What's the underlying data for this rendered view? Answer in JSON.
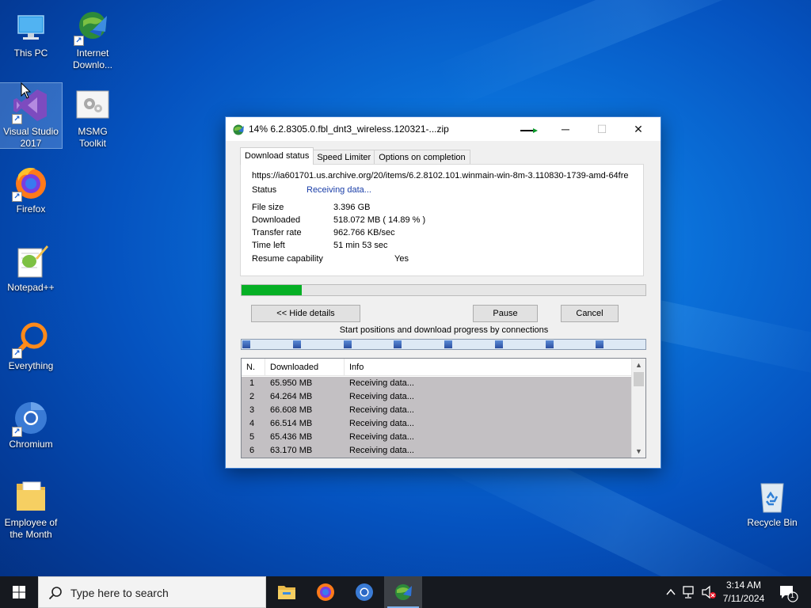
{
  "desktop": {
    "icons": [
      {
        "id": "this-pc",
        "label": "This PC"
      },
      {
        "id": "idm",
        "label": "Internet Downlo..."
      },
      {
        "id": "visual-studio",
        "label": "Visual Studio 2017"
      },
      {
        "id": "msmg",
        "label": "MSMG Toolkit"
      },
      {
        "id": "firefox",
        "label": "Firefox"
      },
      {
        "id": "notepadpp",
        "label": "Notepad++"
      },
      {
        "id": "everything",
        "label": "Everything"
      },
      {
        "id": "chromium",
        "label": "Chromium"
      },
      {
        "id": "employee",
        "label": "Employee of the Month"
      },
      {
        "id": "recycle-bin",
        "label": "Recycle Bin"
      }
    ]
  },
  "idm_window": {
    "title": "14% 6.2.8305.0.fbl_dnt3_wireless.120321-...zip",
    "progress_fraction": 0.1489,
    "tabs": [
      {
        "label": "Download status",
        "active": true
      },
      {
        "label": "Speed Limiter",
        "active": false
      },
      {
        "label": "Options on completion",
        "active": false
      }
    ],
    "url": "https://ia601701.us.archive.org/20/items/6.2.8102.101.winmain-win-8m-3.110830-1739-amd-64fre",
    "status_label": "Status",
    "status_value": "Receiving data...",
    "fields": [
      {
        "label": "File size",
        "value": "3.396  GB"
      },
      {
        "label": "Downloaded",
        "value": "518.072  MB  ( 14.89 % )"
      },
      {
        "label": "Transfer rate",
        "value": "962.766  KB/sec"
      },
      {
        "label": "Time left",
        "value": "51 min 53 sec"
      }
    ],
    "resume_label": "Resume capability",
    "resume_value": "Yes",
    "buttons": {
      "hide_details": "<< Hide details",
      "pause": "Pause",
      "cancel": "Cancel"
    },
    "connections_caption": "Start positions and download progress by connections",
    "connections_count": 8,
    "table": {
      "columns": [
        "N.",
        "Downloaded",
        "Info"
      ],
      "rows": [
        {
          "n": "1",
          "downloaded": "65.950  MB",
          "info": "Receiving data..."
        },
        {
          "n": "2",
          "downloaded": "64.264  MB",
          "info": "Receiving data..."
        },
        {
          "n": "3",
          "downloaded": "66.608  MB",
          "info": "Receiving data..."
        },
        {
          "n": "4",
          "downloaded": "66.514  MB",
          "info": "Receiving data..."
        },
        {
          "n": "5",
          "downloaded": "65.436  MB",
          "info": "Receiving data..."
        },
        {
          "n": "6",
          "downloaded": "63.170  MB",
          "info": "Receiving data..."
        }
      ]
    }
  },
  "taskbar": {
    "search_placeholder": "Type here to search",
    "clock_time": "3:14 AM",
    "clock_date": "7/11/2024",
    "notification_count": "1"
  },
  "colors": {
    "progress_green": "#06b025",
    "status_blue": "#1a3ea8",
    "taskbar_bg": "#16191f"
  }
}
